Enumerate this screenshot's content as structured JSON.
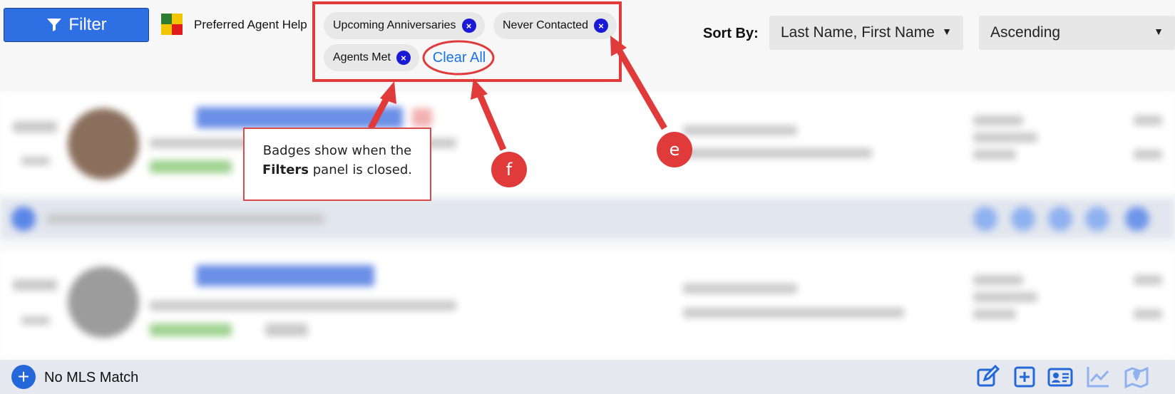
{
  "toolbar": {
    "filter_label": "Filter",
    "help_label": "Preferred Agent Help",
    "badges": [
      {
        "label": "Upcoming Anniversaries"
      },
      {
        "label": "Never Contacted"
      },
      {
        "label": "Agents Met"
      }
    ],
    "badge_remove_glyph": "×",
    "clear_all_label": "Clear All",
    "sort_by_label": "Sort By:",
    "sort_field_value": "Last Name, First Name",
    "sort_order_value": "Ascending",
    "caret": "▼"
  },
  "annotations": {
    "callout_line1": "Badges show when the",
    "callout_bold": "Filters",
    "callout_line2_rest": " panel is closed.",
    "marker_e": "e",
    "marker_f": "f",
    "accent_color": "#e03a3a"
  },
  "footer": {
    "add_glyph": "+",
    "no_mls_label": "No MLS Match",
    "icons": [
      "edit-icon",
      "add-icon",
      "contact-card-icon",
      "chart-line-icon",
      "map-icon"
    ]
  },
  "colors": {
    "primary": "#2f6fe4",
    "badge_x": "#1a1ad6",
    "link": "#1a73e8"
  }
}
